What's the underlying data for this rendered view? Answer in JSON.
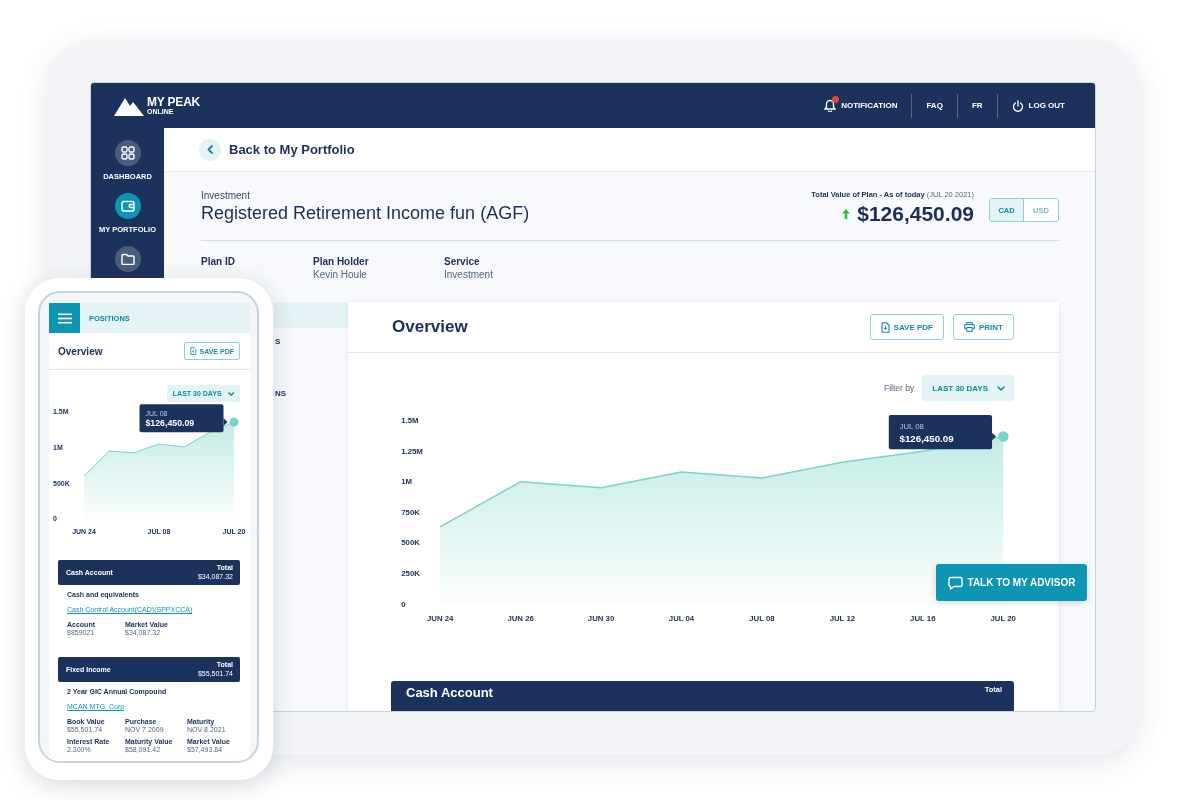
{
  "tablet": {
    "brand": {
      "name": "MY PEAK",
      "sub": "ONLINE"
    },
    "top_nav": [
      {
        "kind": "notification",
        "label": "NOTIFICATION",
        "alert": true
      },
      {
        "kind": "link",
        "label": "FAQ"
      },
      {
        "kind": "link",
        "label": "FR"
      },
      {
        "kind": "logout",
        "label": "LOG OUT"
      }
    ],
    "sidebar": {
      "items": [
        {
          "kind": "dashboard",
          "label": "DASHBOARD",
          "selected": false
        },
        {
          "kind": "portfolio",
          "label": "MY PORTFOLIO",
          "selected": true
        },
        {
          "kind": "folder",
          "selected": false
        }
      ]
    },
    "back_link": "Back to My Portfolio",
    "plan": {
      "category": "Investment",
      "title": "Registered Retirement Income fun (AGF)",
      "total_label": "Total Value of Plan - As of today",
      "total_date": "(JUL 20 2021)",
      "total": "$126,450.09",
      "currencies": [
        {
          "label": "CAD",
          "selected": true
        },
        {
          "label": "USD",
          "selected": false
        }
      ]
    },
    "plan_details": [
      {
        "label": "Plan ID"
      },
      {
        "label": "Plan Holder",
        "value": "Kevin Houle"
      },
      {
        "label": "Service",
        "value": "Investment"
      }
    ],
    "section_nav": [
      {
        "selected": true
      },
      {
        "label": "S",
        "selected": false
      },
      {
        "label": "NS",
        "selected": false
      }
    ],
    "overview": {
      "title": "Overview",
      "actions": [
        {
          "kind": "pdf",
          "label": "SAVE PDF"
        },
        {
          "kind": "print",
          "label": "PRINT"
        }
      ],
      "filter_label": "Filter by",
      "filter": "LAST 30 DAYS",
      "chart_data": {
        "type": "area",
        "categories": [
          "JUN 24",
          "JUN 26",
          "JUN 30",
          "JUL 04",
          "JUL 08",
          "JUL 12",
          "JUL 16",
          "JUL 20"
        ],
        "series": [
          {
            "color": "#79d5c7",
            "values": [
              630000,
              1000000,
              950000,
              1080000,
              1030000,
              1160000,
              1250000,
              1370000
            ]
          }
        ],
        "ylim": [
          0,
          1500000
        ],
        "yticks": [
          {
            "value": 0,
            "label": "0"
          },
          {
            "value": 250000,
            "label": "250K"
          },
          {
            "value": 500000,
            "label": "500K"
          },
          {
            "value": 750000,
            "label": "750K"
          },
          {
            "value": 1000000,
            "label": "1M"
          },
          {
            "value": 1250000,
            "label": "1.25M"
          },
          {
            "value": 1500000,
            "label": "1.5M"
          }
        ]
      },
      "tooltip": {
        "date": "JUL 08",
        "value": "$126,450.09"
      }
    },
    "account_header": {
      "title": "Cash Account",
      "total_label": "Total"
    },
    "advisor_button": "TALK TO MY ADVISOR"
  },
  "phone": {
    "menu_label": "POSITIONS",
    "title": "Overview",
    "action": {
      "label": "SAVE PDF"
    },
    "filter": "LAST 30 DAYS",
    "chart_data": {
      "type": "area",
      "categories": [
        "JUN 24",
        null,
        null,
        "JUL 08",
        null,
        null,
        "JUL 20"
      ],
      "series": [
        {
          "color": "#79d5c7",
          "values": [
            600000,
            950000,
            930000,
            1050000,
            1010000,
            1210000,
            1360000
          ]
        }
      ],
      "ylim": [
        0,
        1500000
      ],
      "yticks": [
        {
          "value": 0,
          "label": "0"
        },
        {
          "value": 500000,
          "label": "500K"
        },
        {
          "value": 1000000,
          "label": "1M"
        },
        {
          "value": 1500000,
          "label": "1.5M"
        }
      ]
    },
    "tooltip": {
      "date": "JUL 08",
      "value": "$126,450.09"
    },
    "accounts": [
      {
        "title": "Cash Account",
        "total_label": "Total",
        "total": "$34,087.32",
        "holding": "Cash and equivalents",
        "link": "Cash Control Account(CAD)(SPPXCCA)",
        "fields": [
          {
            "label": "Account",
            "value": "8859021"
          },
          {
            "label": "Market Value",
            "value": "$34,087.32"
          }
        ]
      },
      {
        "title": "Fixed Income",
        "total_label": "Total",
        "total": "$55,501.74",
        "holding": "2 Year GIC Annual Compound",
        "link": "MCAN MTG. Corp",
        "fields": [
          {
            "label": "Book Value",
            "value": "$55,501.74"
          },
          {
            "label": "Purchase",
            "value": "NOV 7 2009"
          },
          {
            "label": "Maturity",
            "value": "NOV 8 2021"
          },
          {
            "label": "Interest Rate",
            "value": "2.300%"
          },
          {
            "label": "Maturity Value",
            "value": "$58,091.42"
          },
          {
            "label": "Market Value",
            "value": "$57,493.84"
          }
        ]
      }
    ]
  }
}
